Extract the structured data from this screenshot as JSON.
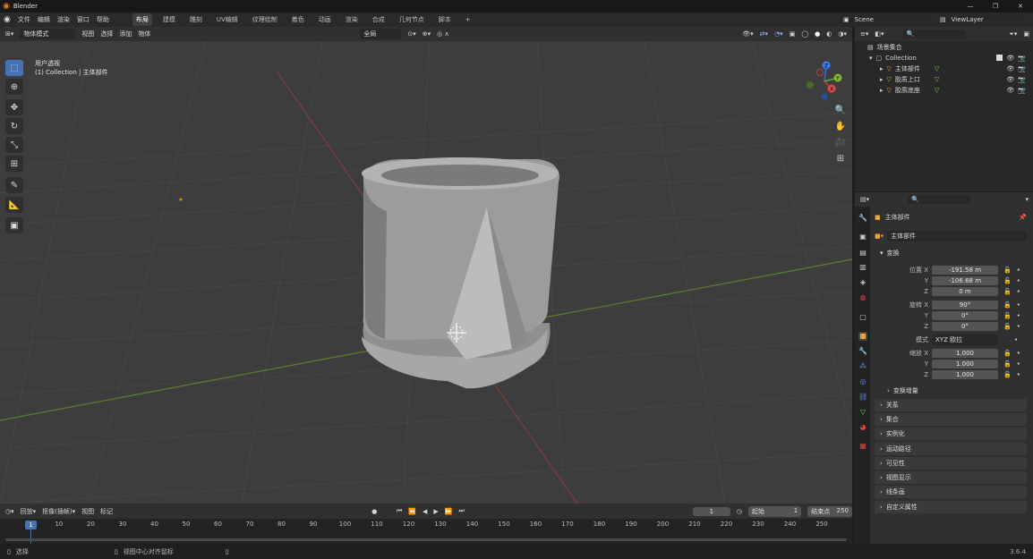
{
  "app": {
    "title": "Blender",
    "version": "3.6.4"
  },
  "menu": [
    "文件",
    "编辑",
    "渲染",
    "窗口",
    "帮助"
  ],
  "workspaces": [
    "布局",
    "建模",
    "雕刻",
    "UV编辑",
    "纹理绘制",
    "着色",
    "动画",
    "渲染",
    "合成",
    "几何节点",
    "脚本"
  ],
  "active_workspace": "布局",
  "scene_name": "Scene",
  "view_layer": "ViewLayer",
  "viewport_header": {
    "mode": "物体模式",
    "menus": [
      "视图",
      "选择",
      "添加",
      "物体"
    ],
    "transform_orientation": "全局",
    "options": "选项"
  },
  "viewport": {
    "view_name": "用户透视",
    "collection_info": "(1) Collection | 主体部件"
  },
  "tools": [
    "select-box",
    "cursor",
    "move",
    "rotate",
    "scale",
    "transform",
    "annotate",
    "measure",
    "add-cube"
  ],
  "gizmo_axes": [
    "X",
    "Y",
    "Z"
  ],
  "outliner": {
    "root": "场景集合",
    "collection": "Collection",
    "objects": [
      "主体部件",
      "胶质上口",
      "胶质底座"
    ]
  },
  "properties": {
    "object_name": "主体部件",
    "mesh_name": "主体部件",
    "section_transform": "变换",
    "location_label": "位置",
    "rotation_label": "旋转",
    "scale_label": "缩放",
    "mode_label": "模式",
    "axis": {
      "x": "X",
      "y": "Y",
      "z": "Z"
    },
    "location": {
      "x": "-191.58 m",
      "y": "-106.68 m",
      "z": "0 m"
    },
    "rotation": {
      "x": "90°",
      "y": "0°",
      "z": "0°"
    },
    "rotation_mode": "XYZ 欧拉",
    "scale": {
      "x": "1.000",
      "y": "1.000",
      "z": "1.000"
    },
    "delta_transform": "变换增量",
    "sections": [
      "关系",
      "集合",
      "实例化",
      "运动路径",
      "可见性",
      "视图显示",
      "线条画",
      "自定义属性"
    ]
  },
  "timeline": {
    "menus": [
      "回放",
      "抠像(插帧)",
      "视图",
      "标记"
    ],
    "current_frame": "1",
    "start_label": "起始",
    "start": "1",
    "end_label": "结束点",
    "end": "250",
    "ticks": [
      "10",
      "20",
      "30",
      "40",
      "50",
      "60",
      "70",
      "80",
      "90",
      "100",
      "110",
      "120",
      "130",
      "140",
      "150",
      "160",
      "170",
      "180",
      "190",
      "200",
      "210",
      "220",
      "230",
      "240",
      "250"
    ],
    "frame_marker": "1"
  },
  "statusbar": {
    "select": "选择",
    "center": "视图中心对齐鼠标",
    "version": "3.6.4"
  }
}
